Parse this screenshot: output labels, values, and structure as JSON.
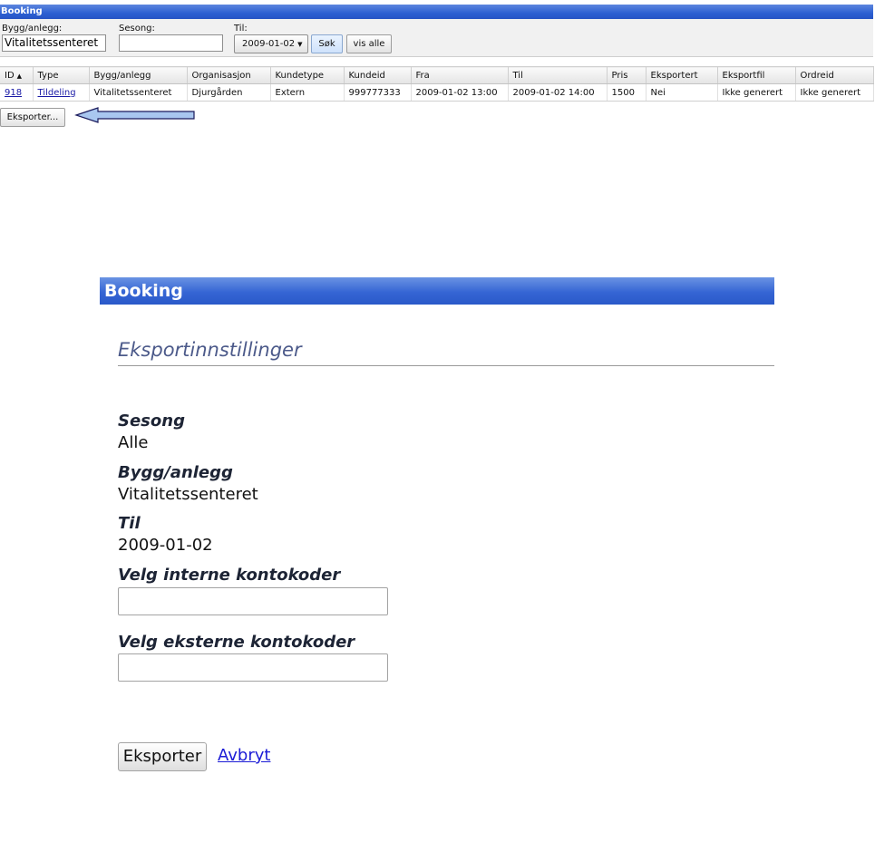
{
  "top": {
    "title": "Booking",
    "filters": {
      "bygg_label": "Bygg/anlegg:",
      "bygg_value": "Vitalitetssenteret",
      "sesong_label": "Sesong:",
      "sesong_value": "",
      "til_label": "Til:",
      "til_value": "2009-01-02",
      "search_label": "Søk",
      "show_all_label": "vis alle"
    },
    "table": {
      "columns": [
        "ID",
        "Type",
        "Bygg/anlegg",
        "Organisasjon",
        "Kundetype",
        "Kundeid",
        "Fra",
        "Til",
        "Pris",
        "Eksportert",
        "Eksportfil",
        "Ordreid"
      ],
      "rows": [
        [
          "918",
          "Tildeling",
          "Vitalitetssenteret",
          "Djurgården",
          "Extern",
          "999777333",
          "2009-01-02 13:00",
          "2009-01-02 14:00",
          "1500",
          "Nei",
          "Ikke generert",
          "Ikke generert"
        ]
      ]
    },
    "export_button": "Eksporter..."
  },
  "dialog": {
    "title": "Booking",
    "heading": "Eksportinnstillinger",
    "sesong_label": "Sesong",
    "sesong_value": "Alle",
    "bygg_label": "Bygg/anlegg",
    "bygg_value": "Vitalitetssenteret",
    "til_label": "Til",
    "til_value": "2009-01-02",
    "interne_label": "Velg interne kontokoder",
    "interne_value": "",
    "eksterne_label": "Velg eksterne kontokoder",
    "eksterne_value": "",
    "submit_label": "Eksporter",
    "cancel_label": "Avbryt"
  },
  "colors": {
    "header_blue": "#2c5fd2",
    "link_blue": "#1c1cd6",
    "arrow_fill": "#a9c7ef"
  }
}
